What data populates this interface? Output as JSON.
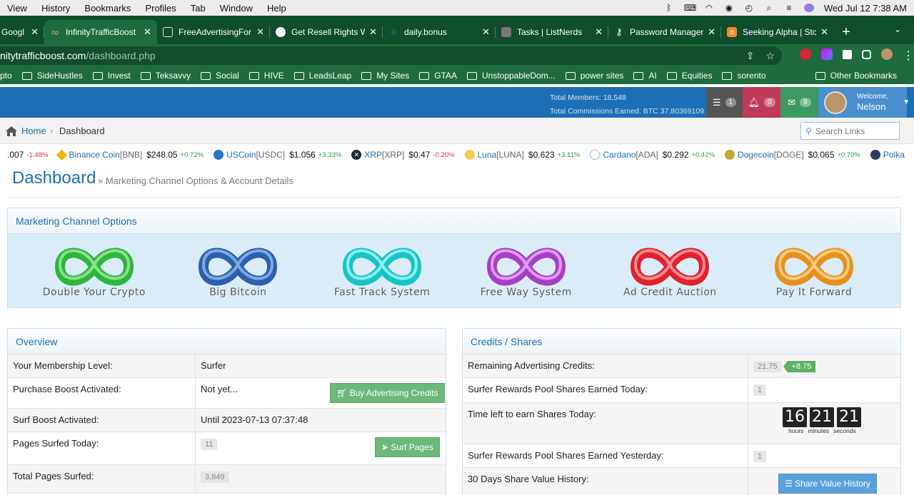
{
  "menubar": {
    "items": [
      "View",
      "History",
      "Bookmarks",
      "Profiles",
      "Tab",
      "Window",
      "Help"
    ],
    "clock": "Wed Jul 12  7:38 AM"
  },
  "tabs": [
    {
      "title": "Googl",
      "fav_color": "#ffffff"
    },
    {
      "title": "InfinityTrafficBoost",
      "fav_color": "#c8a060",
      "active": true
    },
    {
      "title": "FreeAdvertisingFor",
      "fav_color": "#dddddd"
    },
    {
      "title": "Get Resell Rights W",
      "fav_color": "#ffffff"
    },
    {
      "title": "daily.bonus",
      "fav_color": "#4a90e2"
    },
    {
      "title": "Tasks | ListNerds",
      "fav_color": "#888888"
    },
    {
      "title": "Password Manager",
      "fav_color": "#ffffff"
    },
    {
      "title": "Seeking Alpha | Sto",
      "fav_color": "#f08a24"
    }
  ],
  "url": {
    "domain": "nitytrafficboost.com",
    "path": "/dashboard.php"
  },
  "bookmarks": [
    "pto",
    "SideHustles",
    "Invest",
    "Teksavvy",
    "Social",
    "HIVE",
    "LeadsLeap",
    "My Sites",
    "GTAA",
    "UnstoppableDom...",
    "power sites",
    "AI",
    "Equities",
    "sorento"
  ],
  "bookmarks_other": "Other Bookmarks",
  "header": {
    "total_members": "Total Members: 18,548",
    "total_commissions": "Total Commissions Earned: BTC 37.80369109",
    "badge_list": "1",
    "badge_bell": "0",
    "badge_mail": "9",
    "welcome": "Welcome,",
    "user": "Nelson"
  },
  "breadcrumb": {
    "home": "Home",
    "current": "Dashboard",
    "search_placeholder": "Search Links"
  },
  "ticker": [
    {
      "name": "",
      "sym": "",
      "price": ".007",
      "change": "-1.48%",
      "dir": "down",
      "color": ""
    },
    {
      "name": "Binance Coin",
      "sym": "[BNB]",
      "price": "$248.05",
      "change": "+0.72%",
      "dir": "up",
      "color": "#f0b90b"
    },
    {
      "name": "USCoin",
      "sym": "[USDC]",
      "price": "$1.056",
      "change": "+3.33%",
      "dir": "up",
      "color": "#2775ca"
    },
    {
      "name": "XRP",
      "sym": "[XRP]",
      "price": "$0.47",
      "change": "-0.20%",
      "dir": "down",
      "color": "#23292f"
    },
    {
      "name": "Luna",
      "sym": "[LUNA]",
      "price": "$0.623",
      "change": "+3.11%",
      "dir": "up",
      "color": "#f7c948"
    },
    {
      "name": "Cardano",
      "sym": "[ADA]",
      "price": "$0.292",
      "change": "+0.42%",
      "dir": "up",
      "color": "#9ab3d8"
    },
    {
      "name": "Dogecoin",
      "sym": "[DOGE]",
      "price": "$0.065",
      "change": "+0.70%",
      "dir": "up",
      "color": "#c2a633"
    },
    {
      "name": "Polka",
      "sym": "",
      "price": "",
      "change": "",
      "dir": "up",
      "color": "#2d3a66"
    }
  ],
  "page": {
    "title": "Dashboard",
    "subtitle": "» Marketing Channel Options & Account Details"
  },
  "marketing": {
    "heading": "Marketing Channel Options",
    "channels": [
      {
        "label": "Double Your Crypto",
        "color": "#2fb53a",
        "light": "#8be08e"
      },
      {
        "label": "Big Bitcoin",
        "color": "#2c5fae",
        "light": "#7ea8e4"
      },
      {
        "label": "Fast Track System",
        "color": "#19c3c3",
        "light": "#8cf0ee"
      },
      {
        "label": "Free Way System",
        "color": "#a63fc5",
        "light": "#e29af5"
      },
      {
        "label": "Ad Credit Auction",
        "color": "#e0222e",
        "light": "#ff8a8f"
      },
      {
        "label": "Pay It Forward",
        "color": "#e8901e",
        "light": "#ffcd80"
      }
    ]
  },
  "overview": {
    "heading": "Overview",
    "membership_label": "Your Membership Level:",
    "membership_value": "Surfer",
    "purchase_label": "Purchase Boost Activated:",
    "purchase_value": "Not yet...",
    "buy_button": "Buy Advertising Credits",
    "surf_label": "Surf Boost Activated:",
    "surf_value": "Until 2023-07-13 07:37:48",
    "pages_today_label": "Pages Surfed Today:",
    "pages_today_value": "11",
    "surf_button": "Surf Pages",
    "total_pages_label": "Total Pages Surfed:",
    "total_pages_value": "3,849"
  },
  "credits": {
    "heading": "Credits / Shares",
    "remaining_label": "Remaining Advertising Credits:",
    "remaining_value": "21.75",
    "remaining_bonus": "+8.75",
    "shares_today_label": "Surfer Rewards Pool Shares Earned Today:",
    "shares_today_value": "1",
    "time_left_label": "Time left to earn Shares Today:",
    "time_hours": "16",
    "time_minutes": "21",
    "time_seconds": "21",
    "lab_hours": "hours",
    "lab_minutes": "minutes",
    "lab_seconds": "seconds",
    "shares_yesterday_label": "Surfer Rewards Pool Shares Earned Yesterday:",
    "shares_yesterday_value": "1",
    "history_label": "30 Days Share Value History:",
    "history_button": "Share Value History"
  }
}
